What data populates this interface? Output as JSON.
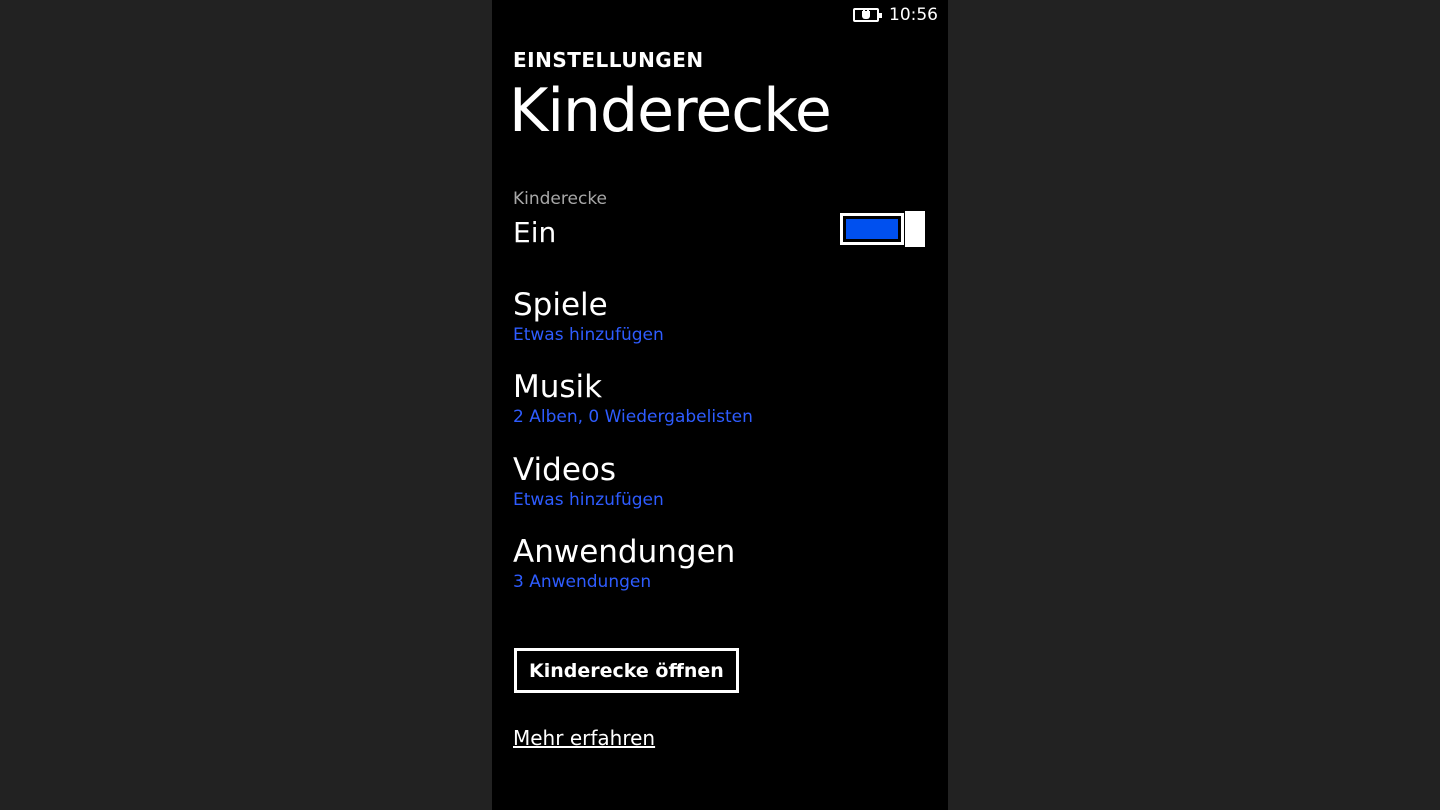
{
  "status_bar": {
    "time": "10:56",
    "battery_icon": "battery-charging-icon"
  },
  "header": {
    "subtitle": "EINSTELLUNGEN",
    "title": "Kinderecke"
  },
  "toggle": {
    "label": "Kinderecke",
    "value": "Ein",
    "state": true,
    "accent_color": "#0050ef"
  },
  "items": [
    {
      "title": "Spiele",
      "subtitle": "Etwas hinzufügen"
    },
    {
      "title": "Musik",
      "subtitle": "2 Alben, 0 Wiedergabelisten"
    },
    {
      "title": "Videos",
      "subtitle": "Etwas hinzufügen"
    },
    {
      "title": "Anwendungen",
      "subtitle": "3 Anwendungen"
    }
  ],
  "actions": {
    "open_button": "Kinderecke öffnen",
    "more_link": "Mehr erfahren"
  },
  "colors": {
    "background": "#000000",
    "outer_background": "#222222",
    "link_blue": "#2e5cff"
  }
}
